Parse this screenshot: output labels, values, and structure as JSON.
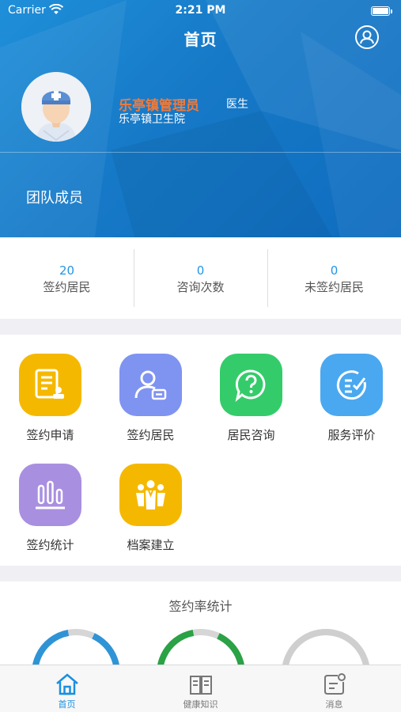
{
  "status_bar": {
    "carrier": "Carrier",
    "time": "2:21 PM"
  },
  "nav": {
    "title": "首页",
    "profile_icon": "user-circle-icon"
  },
  "user": {
    "name": "乐亭镇管理员",
    "role": "医生",
    "organization": "乐亭镇卫生院",
    "avatar_icon": "doctor-avatar-icon"
  },
  "team": {
    "label": "团队成员"
  },
  "stats": [
    {
      "value": "20",
      "label": "签约居民"
    },
    {
      "value": "0",
      "label": "咨询次数"
    },
    {
      "value": "0",
      "label": "未签约居民"
    }
  ],
  "services": [
    {
      "label": "签约申请",
      "icon": "application-form-icon",
      "color": "#f5b800"
    },
    {
      "label": "签约居民",
      "icon": "resident-card-icon",
      "color": "#7f93f0"
    },
    {
      "label": "居民咨询",
      "icon": "question-chat-icon",
      "color": "#34cc6a"
    },
    {
      "label": "服务评价",
      "icon": "checklist-icon",
      "color": "#4aa8f0"
    },
    {
      "label": "签约统计",
      "icon": "bar-stats-icon",
      "color": "#a98fe0"
    },
    {
      "label": "档案建立",
      "icon": "people-group-icon",
      "color": "#f5b800"
    }
  ],
  "sign_rate": {
    "title": "签约率统计",
    "gauges": [
      {
        "color": "#2f94d6",
        "fill": 0.9
      },
      {
        "color": "#2aa245",
        "fill": 0.9
      },
      {
        "color": "#cfcfcf",
        "fill": 1.0
      }
    ]
  },
  "tabbar": {
    "tabs": [
      {
        "label": "首页",
        "icon": "home-icon",
        "active": true
      },
      {
        "label": "健康知识",
        "icon": "book-icon",
        "active": false
      },
      {
        "label": "消息",
        "icon": "message-icon",
        "active": false
      }
    ],
    "active_color": "#1a8fe0"
  }
}
